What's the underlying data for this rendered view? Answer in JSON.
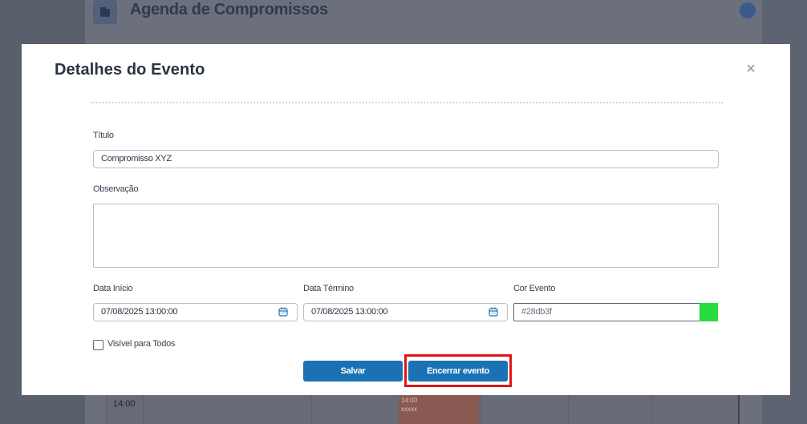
{
  "background_app": {
    "title": "Agenda de Compromissos",
    "time_label": "14:00",
    "event_time": "14:00",
    "event_text": "xxxxx"
  },
  "modal": {
    "title": "Detalhes do Evento",
    "close_label": "×",
    "fields": {
      "titulo": {
        "label": "Título",
        "value": "Compromisso XYZ"
      },
      "observacao": {
        "label": "Observação",
        "value": ""
      },
      "data_inicio": {
        "label": "Data Início",
        "value": "07/08/2025 13:00:00"
      },
      "data_termino": {
        "label": "Data Término",
        "value": "07/08/2025 13:00:00"
      },
      "cor_evento": {
        "label": "Cor Evento",
        "value": "#28db3f",
        "swatch_color": "#28db3f"
      },
      "visivel": {
        "label": "Visível para Todos",
        "checked": false
      }
    },
    "buttons": {
      "salvar": "Salvar",
      "encerrar": "Encerrar evento"
    }
  },
  "colors": {
    "primary": "#1a72b4",
    "highlight": "#e0141a",
    "overlay": "#5e6371"
  },
  "icons": {
    "calendar": "calendar-icon",
    "close": "close-icon"
  }
}
